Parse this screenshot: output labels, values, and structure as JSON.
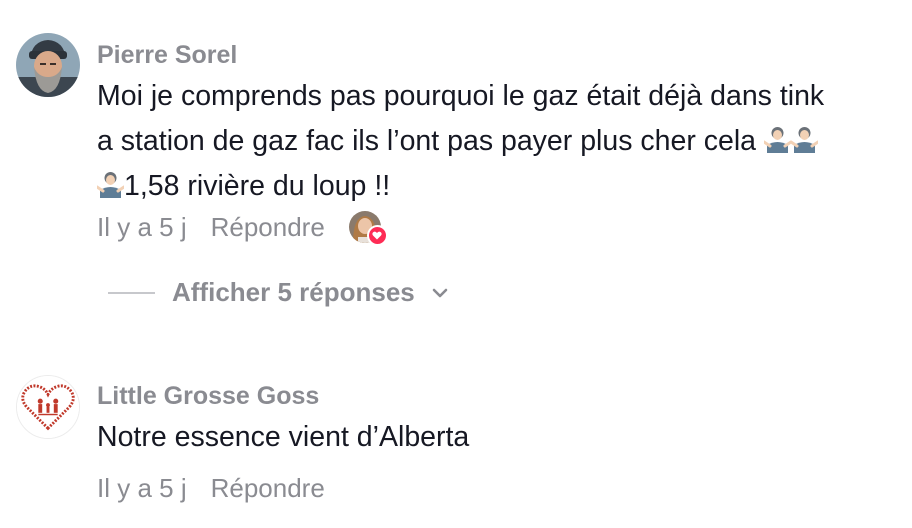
{
  "comments": [
    {
      "author": "Pierre Sorel",
      "text_line1": "Moi je comprends pas pourquoi le gaz était déjà dans tink",
      "text_line2": "a station de gaz fac ils l’ont pas payer plus cher cela",
      "text_line3": "1,58 rivière du loup !!",
      "time": "Il y a 5 j",
      "reply_label": "Répondre",
      "emoji": "person-shrugging"
    },
    {
      "author": "Little Grosse Goss",
      "text": "Notre essence vient d’Alberta",
      "time": "Il y a 5 j",
      "reply_label": "Répondre"
    }
  ],
  "view_replies_label": "Afficher 5 réponses",
  "colors": {
    "meta_gray": "#8a8b91",
    "text": "#161823",
    "like_red": "#fe2c55",
    "heart_logo": "#c0392b"
  }
}
